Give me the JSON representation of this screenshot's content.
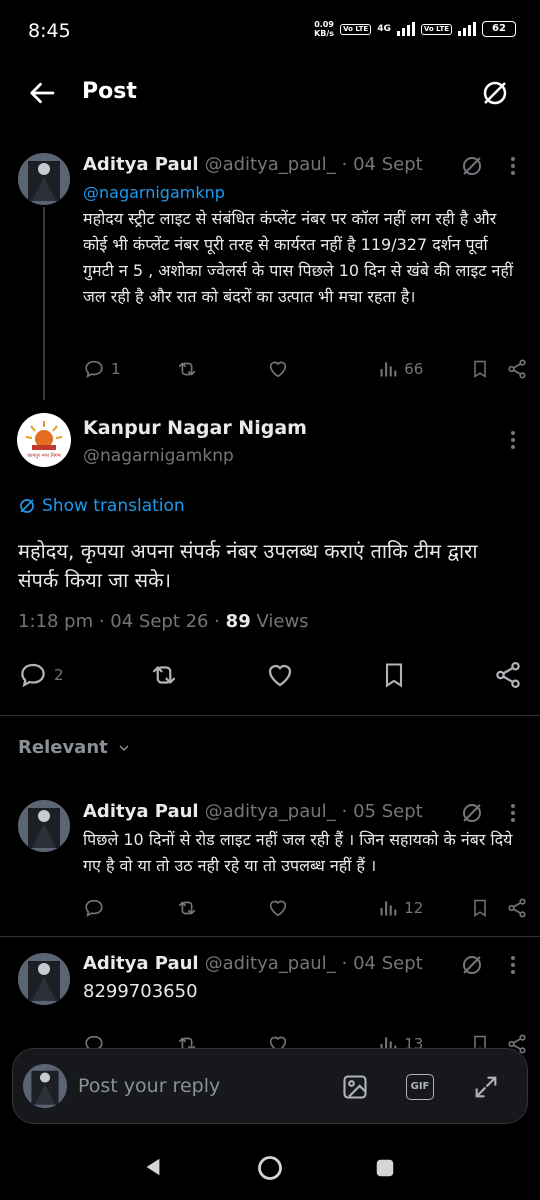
{
  "status": {
    "time": "8:45",
    "net_speed_value": "0.09",
    "net_speed_unit": "KB/s",
    "volte1": "Vo LTE",
    "net_type": "4G",
    "volte2": "Vo LTE",
    "battery": "62"
  },
  "header": {
    "title": "Post"
  },
  "parent_tweet": {
    "name": "Aditya Paul",
    "handle": "@aditya_paul_",
    "date": "· 04 Sept",
    "mention": "@nagarnigamknp",
    "text": "महोदय स्ट्रीट लाइट से संबंधित कंप्लेंट नंबर पर कॉल नहीं लग रही है और कोई भी कंप्लेंट नंबर पूरी तरह से कार्यरत नहीं है 119/327 दर्शन पूर्वा गुमटी न 5 , अशोका ज्वेलर्स के पास पिछले 10 दिन से खंबे की लाइट नहीं जल रही है और रात को बंदरों का उत्पात भी मचा रहता है।",
    "replies": "1",
    "views": "66"
  },
  "main_tweet": {
    "name": "Kanpur Nagar Nigam",
    "handle": "@nagarnigamknp",
    "show_translation": "Show translation",
    "text": "महोदय, कृपया अपना संपर्क नंबर उपलब्ध कराएं ताकि टीम द्वारा संपर्क किया जा सके।",
    "time": "1:18 pm · 04 Sept 26 · ",
    "views_count": "89",
    "views_label": " Views",
    "replies": "2"
  },
  "relevant": {
    "label": "Relevant"
  },
  "reply1": {
    "name": "Aditya Paul",
    "handle": "@aditya_paul_",
    "date": "· 05 Sept",
    "text": "पिछले 10 दिनों से रोड लाइट नहीं जल रही हैं । जिन सहायको के नंबर दिये गए है वो या तो उठ नही रहे या तो उपलब्ध नहीं हैं ।",
    "views": "12"
  },
  "reply2": {
    "name": "Aditya Paul",
    "handle": "@aditya_paul_",
    "date": "· 04 Sept",
    "text": "8299703650",
    "views": "13"
  },
  "reply_bar": {
    "placeholder": "Post your reply",
    "gif": "GIF"
  },
  "logo": {
    "text": "कानपुर नगर निगम"
  }
}
